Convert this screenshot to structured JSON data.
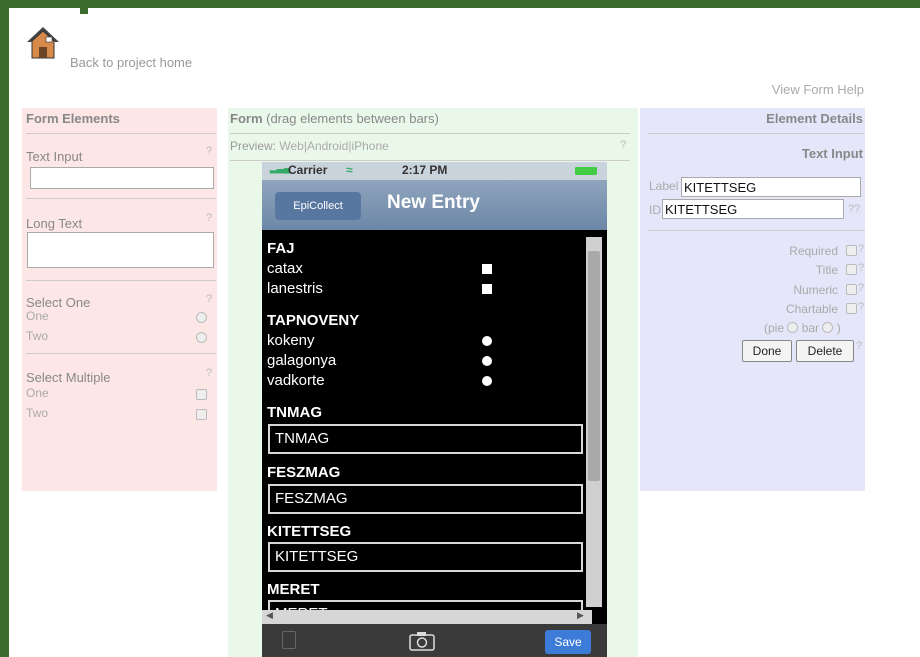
{
  "header": {
    "back_link": "Back to project home",
    "help_link": "View Form Help"
  },
  "left": {
    "title": "Form Elements",
    "text_input": "Text Input",
    "long_text": "Long Text",
    "select_one": "Select One",
    "select_one_options": [
      "One",
      "Two"
    ],
    "select_multiple": "Select Multiple",
    "select_multiple_options": [
      "One",
      "Two"
    ],
    "help": "?"
  },
  "middle": {
    "title": "Form",
    "subtitle": "(drag elements between bars)",
    "preview_label": "Preview:",
    "preview_links": [
      "Web",
      "Android",
      "iPhone"
    ],
    "help": "?"
  },
  "phone": {
    "carrier": "Carrier",
    "time": "2:17 PM",
    "back_button": "EpiCollect",
    "nav_title": "New Entry",
    "save_button": "Save",
    "fields": {
      "faj": {
        "label": "FAJ",
        "options": [
          "catax",
          "lanestris"
        ]
      },
      "tapnoveny": {
        "label": "TAPNOVENY",
        "options": [
          "kokeny",
          "galagonya",
          "vadkorte"
        ]
      },
      "tnmag": {
        "label": "TNMAG",
        "value": "TNMAG"
      },
      "feszmag": {
        "label": "FESZMAG",
        "value": "FESZMAG"
      },
      "kitettseg": {
        "label": "KITETTSEG",
        "value": "KITETTSEG"
      },
      "meret": {
        "label": "MERET",
        "value": "MERET"
      }
    }
  },
  "right": {
    "title": "Element Details",
    "element_type": "Text Input",
    "label_caption": "Label",
    "label_value": "KITETTSEG",
    "id_caption": "ID",
    "id_value": "KITETTSEG",
    "id_help": "??",
    "required": "Required",
    "title_opt": "Title",
    "numeric": "Numeric",
    "chartable": "Chartable",
    "pie_open": "(pie",
    "bar": "bar",
    "paren_close": ")",
    "done_button": "Done",
    "delete_button": "Delete",
    "help": "?"
  }
}
